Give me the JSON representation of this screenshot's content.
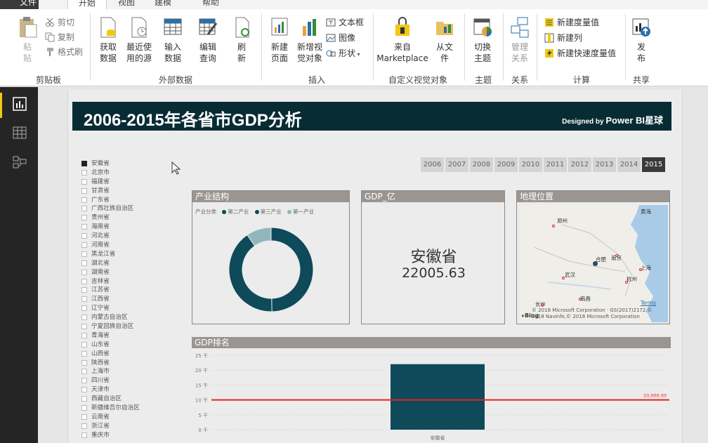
{
  "tabs": {
    "file": "文件",
    "home": "开始",
    "view": "视图",
    "model": "建模",
    "help": "帮助"
  },
  "ribbon": {
    "clipboard": {
      "paste": "粘\n贴",
      "cut": "剪切",
      "copy": "复制",
      "format_painter": "格式刷",
      "label": "剪贴板"
    },
    "external": {
      "get_data": "获取\n数据",
      "recent_sources": "最近使\n用的源",
      "enter_data": "输入\n数据",
      "edit_queries": "编辑\n查询",
      "refresh": "刷\n新",
      "label": "外部数据"
    },
    "insert": {
      "new_page": "新建\n页面",
      "new_visual": "新增视\n觉对象",
      "textbox": "文本框",
      "image": "图像",
      "shapes": "形状",
      "label": "插入"
    },
    "custom_visuals": {
      "marketplace": "来自\nMarketplace",
      "from_file": "从文\n件",
      "label": "自定义视觉对象"
    },
    "themes": {
      "switch_theme": "切换\n主题",
      "label": "主题"
    },
    "relationships": {
      "manage": "管理\n关系",
      "label": "关系"
    },
    "calculations": {
      "new_measure": "新建度量值",
      "new_column": "新建列",
      "new_quick_measure": "新建快速度量值",
      "label": "计算"
    },
    "share": {
      "publish": "发\n布",
      "label": "共享"
    }
  },
  "report": {
    "title": "2006-2015年各省市GDP分析",
    "designed_by": "Designed by",
    "brand": "Power BI星球"
  },
  "provinces": [
    "安徽省",
    "北京市",
    "福建省",
    "甘肃省",
    "广东省",
    "广西壮族自治区",
    "贵州省",
    "海南省",
    "河北省",
    "河南省",
    "黑龙江省",
    "湖北省",
    "湖南省",
    "吉林省",
    "江苏省",
    "江西省",
    "辽宁省",
    "内蒙古自治区",
    "宁夏回族自治区",
    "青海省",
    "山东省",
    "山西省",
    "陕西省",
    "上海市",
    "四川省",
    "天津市",
    "西藏自治区",
    "新疆维吾尔自治区",
    "云南省",
    "浙江省",
    "重庆市"
  ],
  "selected_province": "安徽省",
  "years": [
    "2006",
    "2007",
    "2008",
    "2009",
    "2010",
    "2011",
    "2012",
    "2013",
    "2014",
    "2015"
  ],
  "selected_year": "2015",
  "panels": {
    "structure": "产业结构",
    "gdp": "GDP_亿",
    "location": "地理位置",
    "rank": "GDP排名"
  },
  "structure_legend": {
    "title": "产业分类",
    "items": [
      {
        "name": "第二产业",
        "color": "#0e4a5a"
      },
      {
        "name": "第三产业",
        "color": "#0e4a5a"
      },
      {
        "name": "第一产业",
        "color": "#93b6bd"
      }
    ]
  },
  "gdp_card": {
    "province": "安徽省",
    "value": "22005.63"
  },
  "map": {
    "cities": [
      "黄海",
      "郑州",
      "合肥",
      "南京",
      "上海",
      "武汉",
      "杭州",
      "南昌",
      "长沙"
    ],
    "terms": "Terms",
    "copyright": "© 2018 Microsoft Corporation · GS(2017)2172,©\n2018 NavInfo,© 2018 Microsoft Corporation",
    "logo": "Bing"
  },
  "chart_data": [
    {
      "type": "pie",
      "title": "产业结构",
      "legend_title": "产业分类",
      "categories": [
        "第二产业",
        "第三产业",
        "第一产业"
      ],
      "values": [
        49.7,
        40.7,
        9.6
      ],
      "colors": [
        "#0e4a5a",
        "#0e4a5a",
        "#93b6bd"
      ],
      "donut": true
    },
    {
      "type": "bar",
      "title": "GDP排名",
      "categories": [
        "安徽省"
      ],
      "values": [
        22005.63
      ],
      "ylim": [
        0,
        25000
      ],
      "yticks": [
        "0 千",
        "5 千",
        "10 千",
        "15 千",
        "20 千",
        "25 千"
      ],
      "reference_line": {
        "value": 10000,
        "label": "10,000.00",
        "color": "#e81f1f"
      },
      "bar_color": "#0e4a5a",
      "grid": true
    }
  ]
}
